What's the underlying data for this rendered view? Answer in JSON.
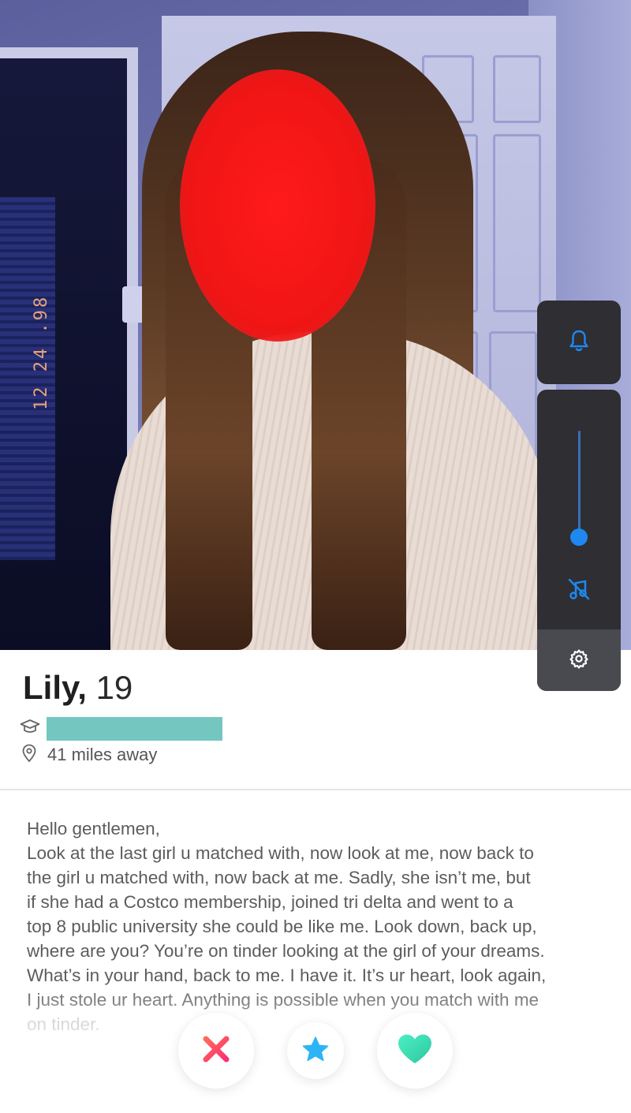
{
  "photo": {
    "camera_timestamp": "12 24 .98",
    "face_redaction_color": "#f21515"
  },
  "volume_overlay": {
    "ringer_icon": "bell-icon",
    "volume_level": 0.8,
    "mute_icon": "music-off-icon",
    "settings_icon": "gear-icon",
    "accent_color": "#1e88f0"
  },
  "profile": {
    "name": "Lily,",
    "age": "19",
    "school_icon": "graduation-cap-icon",
    "school_redaction_color": "#74c7c0",
    "location_icon": "location-pin-icon",
    "distance": "41 miles away"
  },
  "bio": {
    "lines": [
      "Hello gentlemen,",
      "Look at the last girl u matched with, now look at me, now back to",
      "the girl u matched with, now back at me. Sadly, she isn’t me, but",
      "if she had a Costco membership, joined tri delta and  went to a",
      "top 8 public university she could be like me. Look down, back up,",
      "where are you? You’re on tinder looking at the girl of your dreams.",
      "What’s in your hand, back to me. I have it. It’s ur heart, look again,",
      "I just stole ur heart. Anything is possible when you match with me",
      "on tinder."
    ]
  },
  "actions": {
    "nope_icon": "x-icon",
    "super_like_icon": "star-icon",
    "like_icon": "heart-icon",
    "nope_color": "#fd5068",
    "super_like_color": "#2db4f5",
    "like_color": "#3fdbb0"
  }
}
